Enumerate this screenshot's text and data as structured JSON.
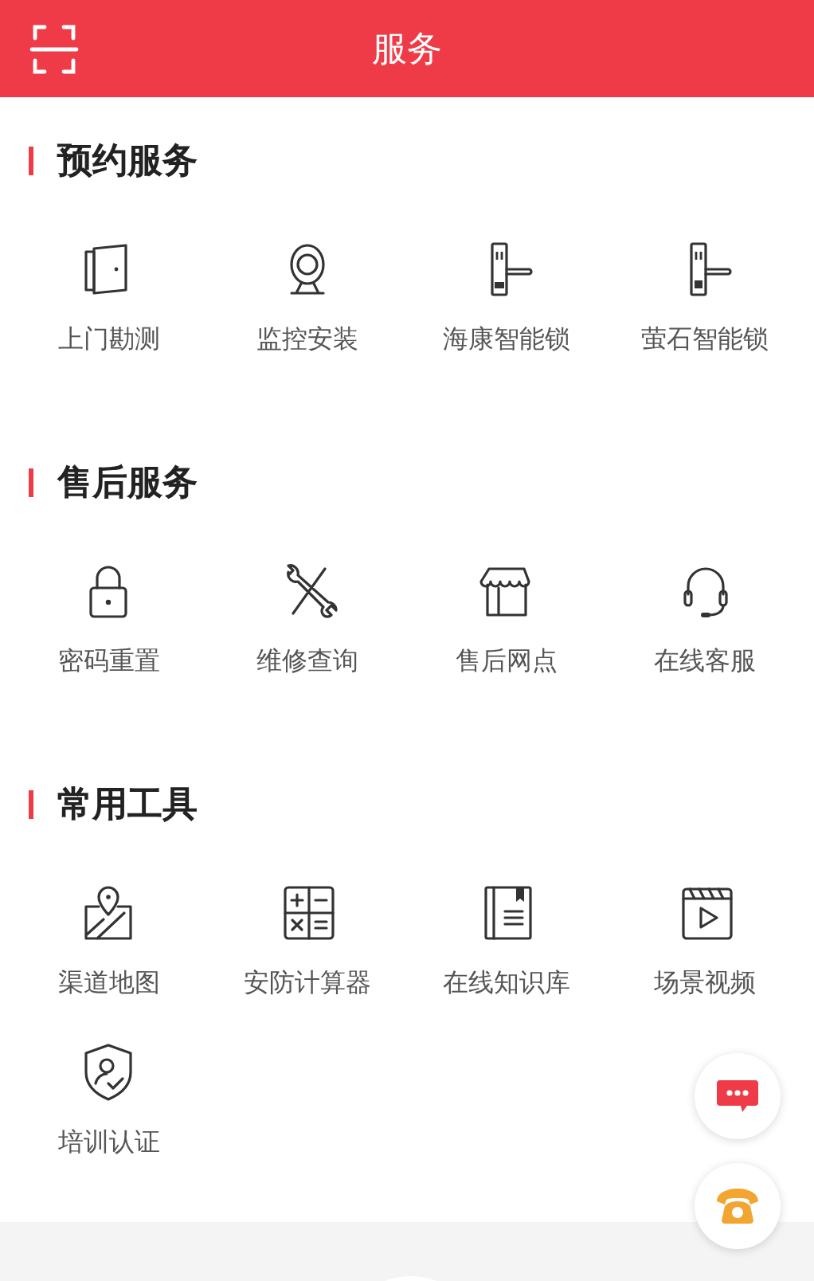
{
  "header": {
    "title": "服务"
  },
  "sections": [
    {
      "title": "预约服务",
      "items": [
        {
          "label": "上门勘测"
        },
        {
          "label": "监控安装"
        },
        {
          "label": "海康智能锁"
        },
        {
          "label": "萤石智能锁"
        }
      ]
    },
    {
      "title": "售后服务",
      "items": [
        {
          "label": "密码重置"
        },
        {
          "label": "维修查询"
        },
        {
          "label": "售后网点"
        },
        {
          "label": "在线客服"
        }
      ]
    },
    {
      "title": "常用工具",
      "items": [
        {
          "label": "渠道地图"
        },
        {
          "label": "安防计算器"
        },
        {
          "label": "在线知识库"
        },
        {
          "label": "场景视频"
        },
        {
          "label": "培训认证"
        }
      ]
    }
  ]
}
